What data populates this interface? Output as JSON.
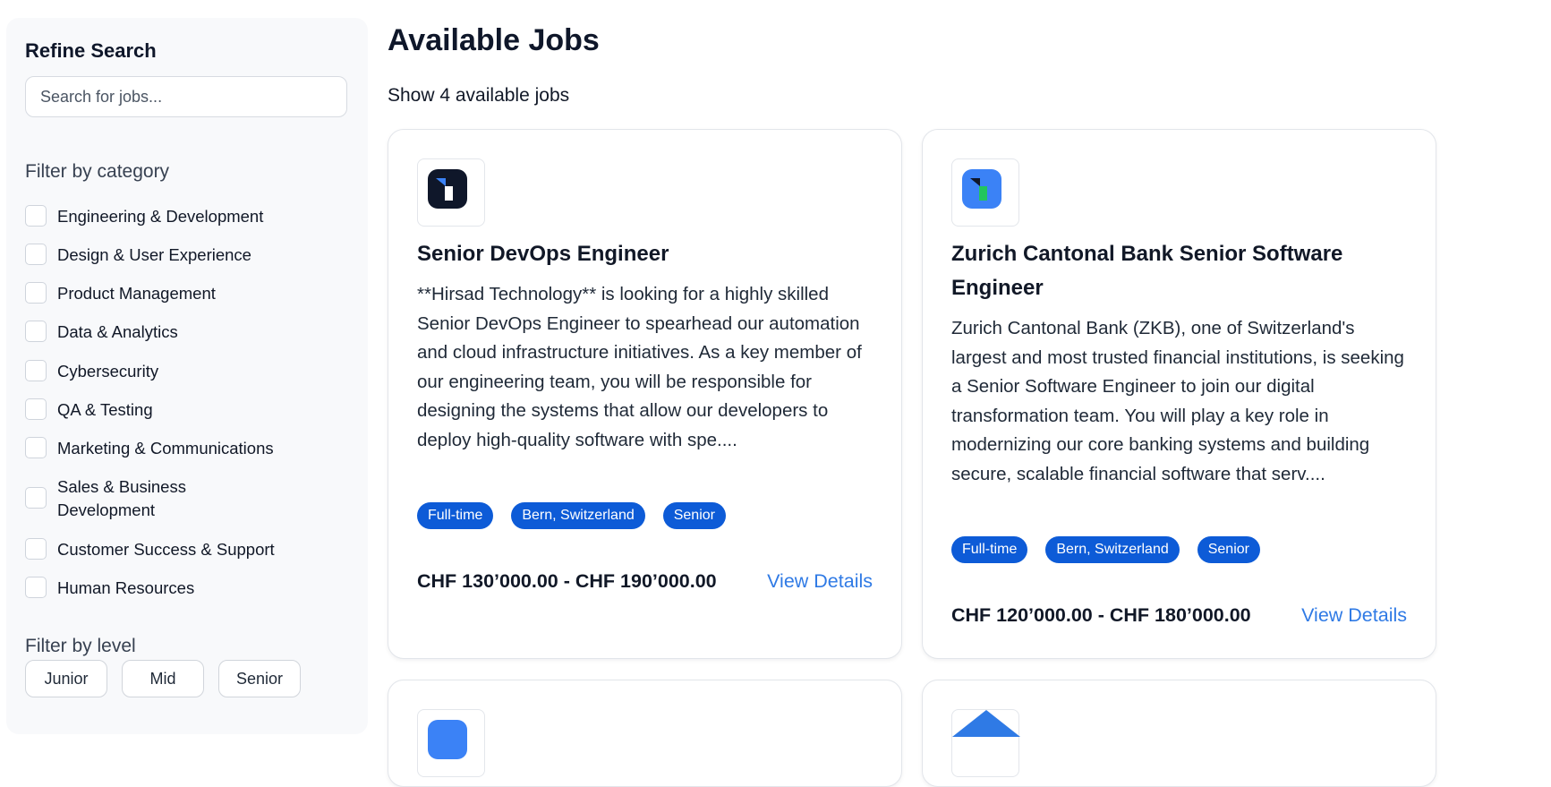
{
  "sidebar": {
    "title": "Refine Search",
    "search_placeholder": "Search for jobs...",
    "category_title": "Filter by category",
    "categories": [
      "Engineering & Development",
      "Design & User Experience",
      "Product Management",
      "Data & Analytics",
      "Cybersecurity",
      "QA & Testing",
      "Marketing & Communications",
      "Sales & Business Development",
      "Customer Success & Support",
      "Human Resources"
    ],
    "level_title": "Filter by level",
    "levels": [
      "Junior",
      "Mid",
      "Senior"
    ]
  },
  "main": {
    "title": "Available Jobs",
    "count_text": "Show 4 available jobs",
    "jobs": [
      {
        "title": "Senior DevOps Engineer",
        "description": "**Hirsad Technology** is looking for a highly skilled Senior DevOps Engineer to spearhead our automation and cloud infrastructure initiatives. As a key member of our engineering team, you will be responsible for designing the systems that allow our developers to deploy high-quality software with spe....",
        "tags": [
          "Full-time",
          "Bern, Switzerland",
          "Senior"
        ],
        "salary": "CHF 130’000.00 - CHF 190’000.00",
        "link": "View Details",
        "logo": "hirsad-logo-icon",
        "logo_color": "#0f172a"
      },
      {
        "title": "Zurich Cantonal Bank Senior Software Engineer",
        "description": "Zurich Cantonal Bank (ZKB), one of Switzerland's largest and most trusted financial institutions, is seeking a Senior Software Engineer to join our digital transformation team. You will play a key role in modernizing our core banking systems and building secure, scalable financial software that serv....",
        "tags": [
          "Full-time",
          "Bern, Switzerland",
          "Senior"
        ],
        "salary": "CHF 120’000.00 - CHF 180’000.00",
        "link": "View Details",
        "logo": "zkb-logo-icon",
        "logo_color": "#3b82f6"
      }
    ]
  },
  "colors": {
    "tag_bg": "#0d5bd7",
    "link": "#2f7ae5",
    "sidebar_bg": "#f8f9fb"
  }
}
